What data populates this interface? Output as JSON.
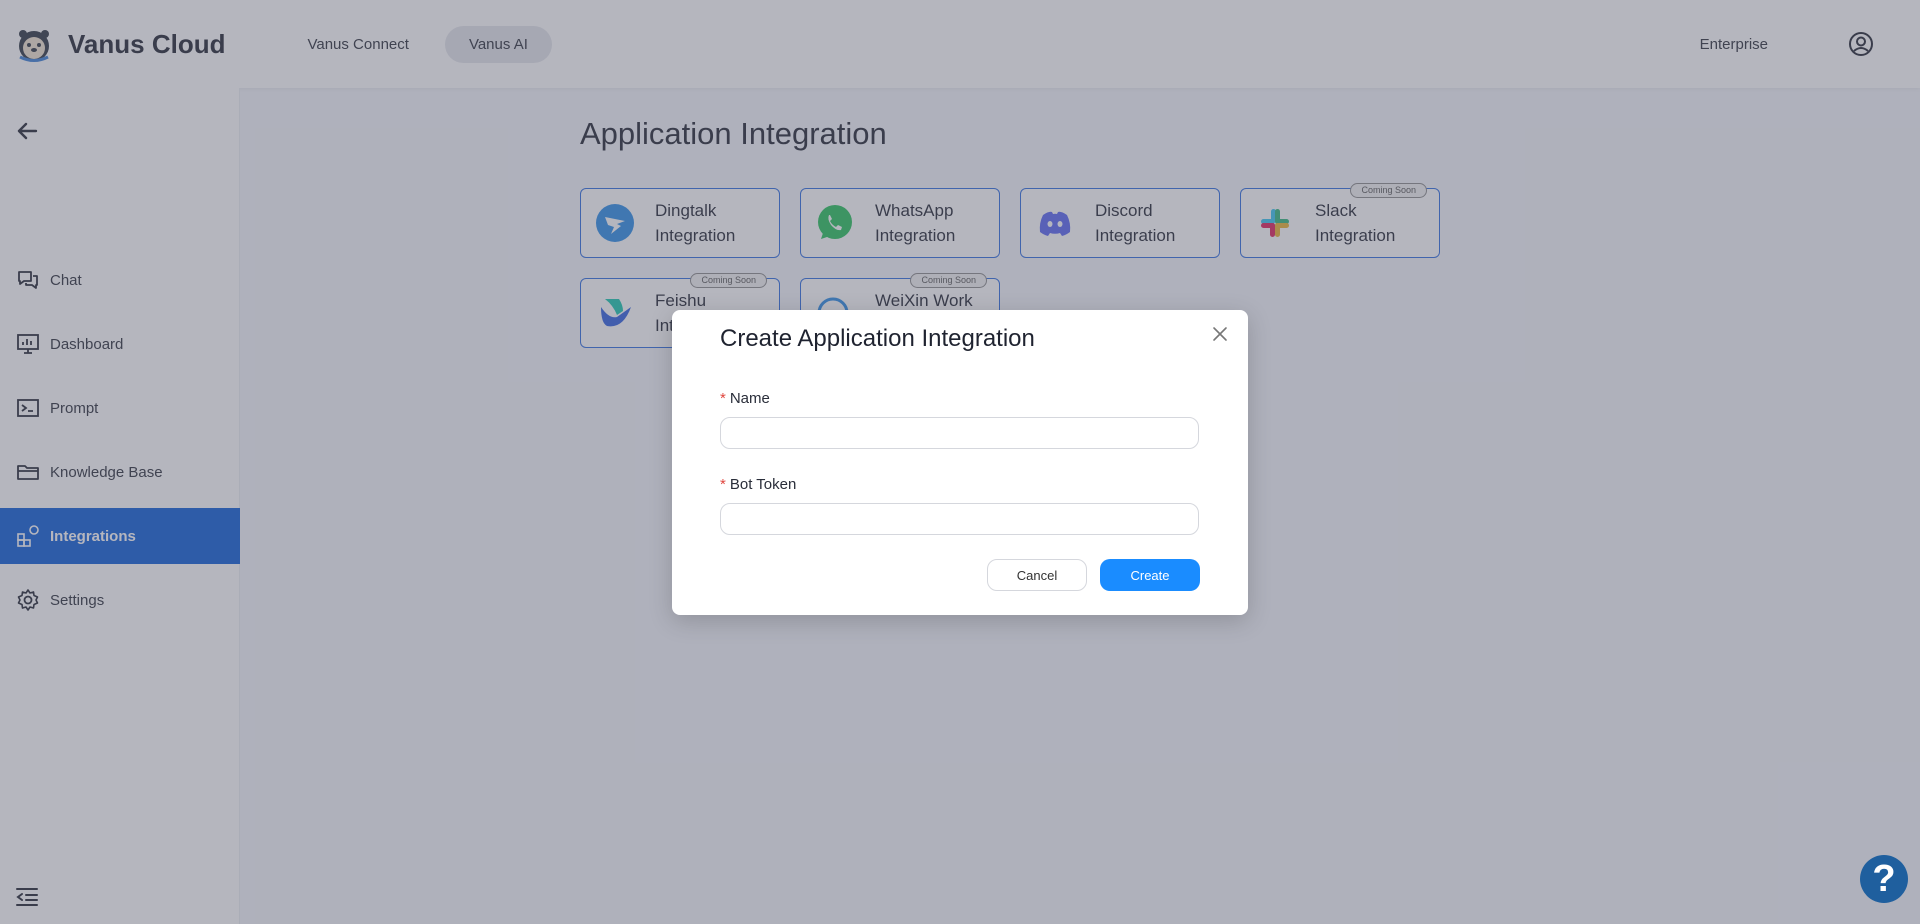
{
  "header": {
    "brand": "Vanus Cloud",
    "tabs": [
      {
        "label": "Vanus Connect"
      },
      {
        "label": "Vanus AI"
      }
    ],
    "enterprise_label": "Enterprise"
  },
  "sidebar": {
    "items": [
      {
        "label": "Chat",
        "icon": "chat-icon"
      },
      {
        "label": "Dashboard",
        "icon": "dashboard-icon"
      },
      {
        "label": "Prompt",
        "icon": "terminal-icon"
      },
      {
        "label": "Knowledge Base",
        "icon": "folder-icon"
      },
      {
        "label": "Integrations",
        "icon": "integrations-icon",
        "active": true
      },
      {
        "label": "Settings",
        "icon": "gear-icon"
      }
    ]
  },
  "main": {
    "title": "Application Integration",
    "cards": [
      {
        "label": "Dingtalk Integration",
        "icon": "dingtalk-icon",
        "badge": ""
      },
      {
        "label": "WhatsApp Integration",
        "icon": "whatsapp-icon",
        "badge": ""
      },
      {
        "label": "Discord Integration",
        "icon": "discord-icon",
        "badge": ""
      },
      {
        "label": "Slack Integration",
        "icon": "slack-icon",
        "badge": "Coming Soon"
      },
      {
        "label": "Feishu Integration",
        "icon": "feishu-icon",
        "badge": "Coming Soon"
      },
      {
        "label": "WeiXin Work Integration",
        "icon": "weixin-work-icon",
        "badge": "Coming Soon"
      }
    ]
  },
  "modal": {
    "title": "Create Application Integration",
    "fields": [
      {
        "label": "Name",
        "required_mark": "*",
        "value": "",
        "placeholder": ""
      },
      {
        "label": "Bot Token",
        "required_mark": "*",
        "value": "",
        "placeholder": ""
      }
    ],
    "cancel_label": "Cancel",
    "create_label": "Create"
  },
  "help": {
    "label": "?"
  },
  "colors": {
    "accent": "#0a5bd8",
    "primary_button": "#1a8cff",
    "card_border": "#2d6ce0",
    "required": "#e0463e"
  }
}
